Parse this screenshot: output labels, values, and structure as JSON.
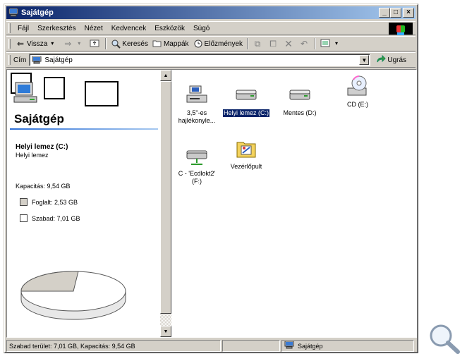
{
  "window": {
    "title": "Sajátgép",
    "controls": {
      "minimize": "_",
      "maximize": "□",
      "close": "×"
    }
  },
  "menu": [
    "Fájl",
    "Szerkesztés",
    "Nézet",
    "Kedvencek",
    "Eszközök",
    "Súgó"
  ],
  "toolbar": {
    "back": "Vissza",
    "search": "Keresés",
    "folders": "Mappák",
    "history": "Előzmények"
  },
  "address": {
    "label": "Cím",
    "value": "Sajátgép",
    "go": "Ugrás"
  },
  "left_pane": {
    "title": "Sajátgép",
    "selected_name": "Helyi lemez (C:)",
    "selected_type": "Helyi lemez",
    "capacity": "Kapacitás: 9,54 GB",
    "used": "Foglalt: 2,53 GB",
    "free": "Szabad: 7,01 GB",
    "used_color": "#d4d0c8",
    "free_color": "#ffffff",
    "used_fraction": 0.265
  },
  "drives": [
    {
      "label": "3,5\"-es hajlékonyle...",
      "icon": "floppy-drive-icon"
    },
    {
      "label": "Helyi lemez (C:)",
      "icon": "hard-disk-icon",
      "selected": true
    },
    {
      "label": "Mentes (D:)",
      "icon": "hard-disk-icon"
    },
    {
      "label": "CD (E:)",
      "icon": "cd-drive-icon"
    },
    {
      "label": "C - 'Ecdlokt2' (F:)",
      "icon": "network-drive-icon"
    },
    {
      "label": "Vezérlőpult",
      "icon": "control-panel-icon"
    }
  ],
  "status": {
    "summary": "Szabad terület: 7,01 GB, Kapacitás: 9,54 GB",
    "zone": "Sajátgép"
  },
  "colors": {
    "titlebar_start": "#0a246a",
    "titlebar_end": "#a6caf0",
    "selection": "#0a246a",
    "face": "#d4d0c8"
  }
}
